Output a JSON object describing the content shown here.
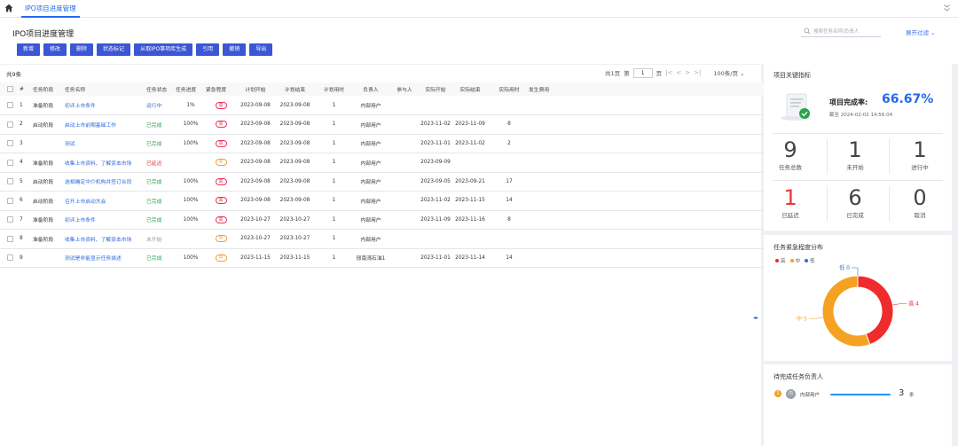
{
  "topbar": {
    "tab": "IPO项目进度管理"
  },
  "header": {
    "title": "IPO项目进度管理",
    "buttons": [
      "新增",
      "修改",
      "删除",
      "状态标记",
      "从取IPO事项库生成",
      "引用",
      "撤销",
      "导出"
    ],
    "search_placeholder": "搜索任务名称/负责人",
    "expand_label": "展开过滤"
  },
  "table": {
    "count_label": "共9条",
    "pager": {
      "total_pages": "共1页",
      "page_label": "第",
      "current_page": "1",
      "page_suffix": "页",
      "page_size": "100条/页"
    },
    "columns": [
      "#",
      "任务阶段",
      "任务名称",
      "任务状态",
      "任务进度",
      "紧急程度",
      "计划开始",
      "计划结束",
      "计划用时",
      "负责人",
      "参与人",
      "实际开始",
      "实际结束",
      "实际用时",
      "发生费用"
    ],
    "rows": [
      {
        "no": "1",
        "stage": "准备阶段",
        "name": "初评上市条件",
        "status": "运行中",
        "status_type": "run",
        "progress": "1%",
        "priority": "高",
        "priority_type": "h",
        "plan_start": "2023-09-08",
        "plan_end": "2023-09-08",
        "plan_days": "1",
        "owner": "内部用户",
        "participants": "",
        "act_start": "",
        "act_end": "",
        "act_days": "",
        "cost": ""
      },
      {
        "no": "2",
        "stage": "启动阶段",
        "name": "启动上市前期基础工作",
        "status": "已完成",
        "status_type": "done",
        "progress": "100%",
        "priority": "高",
        "priority_type": "h",
        "plan_start": "2023-09-08",
        "plan_end": "2023-09-08",
        "plan_days": "1",
        "owner": "内部用户",
        "participants": "",
        "act_start": "2023-11-02",
        "act_end": "2023-11-09",
        "act_days": "8",
        "cost": ""
      },
      {
        "no": "3",
        "stage": "",
        "name": "测试",
        "status": "已完成",
        "status_type": "done",
        "progress": "100%",
        "priority": "高",
        "priority_type": "h",
        "plan_start": "2023-09-08",
        "plan_end": "2023-09-08",
        "plan_days": "1",
        "owner": "内部用户",
        "participants": "",
        "act_start": "2023-11-01",
        "act_end": "2023-11-02",
        "act_days": "2",
        "cost": ""
      },
      {
        "no": "4",
        "stage": "准备阶段",
        "name": "收集上市资料、了解资本市场",
        "status": "已延迟",
        "status_type": "late",
        "progress": "",
        "priority": "中",
        "priority_type": "m",
        "plan_start": "2023-09-08",
        "plan_end": "2023-09-08",
        "plan_days": "1",
        "owner": "内部用户",
        "participants": "",
        "act_start": "2023-09-09",
        "act_end": "",
        "act_days": "",
        "cost": ""
      },
      {
        "no": "5",
        "stage": "启动阶段",
        "name": "选相确定中介机构并签订合同",
        "status": "已完成",
        "status_type": "done",
        "progress": "100%",
        "priority": "高",
        "priority_type": "h",
        "plan_start": "2023-09-08",
        "plan_end": "2023-09-08",
        "plan_days": "1",
        "owner": "内部用户",
        "participants": "",
        "act_start": "2023-09-05",
        "act_end": "2023-09-21",
        "act_days": "17",
        "cost": ""
      },
      {
        "no": "6",
        "stage": "启动阶段",
        "name": "召开上市启动大会",
        "status": "已完成",
        "status_type": "done",
        "progress": "100%",
        "priority": "高",
        "priority_type": "h",
        "plan_start": "2023-09-08",
        "plan_end": "2023-09-08",
        "plan_days": "1",
        "owner": "内部用户",
        "participants": "",
        "act_start": "2023-11-02",
        "act_end": "2023-11-15",
        "act_days": "14",
        "cost": ""
      },
      {
        "no": "7",
        "stage": "准备阶段",
        "name": "初评上市条件",
        "status": "已完成",
        "status_type": "done",
        "progress": "100%",
        "priority": "高",
        "priority_type": "h",
        "plan_start": "2023-10-27",
        "plan_end": "2023-10-27",
        "plan_days": "1",
        "owner": "内部用户",
        "participants": "",
        "act_start": "2023-11-09",
        "act_end": "2023-11-16",
        "act_days": "8",
        "cost": ""
      },
      {
        "no": "8",
        "stage": "准备阶段",
        "name": "收集上市资料、了解资本市场",
        "status": "未开始",
        "status_type": "todo",
        "progress": "",
        "priority": "中",
        "priority_type": "m",
        "plan_start": "2023-10-27",
        "plan_end": "2023-10-27",
        "plan_days": "1",
        "owner": "内部用户",
        "participants": "",
        "act_start": "",
        "act_end": "",
        "act_days": "",
        "cost": ""
      },
      {
        "no": "9",
        "stage": "",
        "name": "测试是非能显示任务描述",
        "status": "已完成",
        "status_type": "done",
        "progress": "100%",
        "priority": "中",
        "priority_type": "m",
        "plan_start": "2023-11-15",
        "plan_end": "2023-11-15",
        "plan_days": "1",
        "owner": "邢南湾石油1",
        "participants": "",
        "act_start": "2023-11-01",
        "act_end": "2023-11-14",
        "act_days": "14",
        "cost": ""
      }
    ]
  },
  "kpi": {
    "title": "项目关键指标",
    "rate_label": "项目完成率:",
    "rate_value": "66.67%",
    "timestamp": "截至 2024-02-02 14:56:04",
    "stats": [
      {
        "num": "9",
        "label": "任务总数",
        "color": "#444444"
      },
      {
        "num": "1",
        "label": "未开始",
        "color": "#444444"
      },
      {
        "num": "1",
        "label": "进行中",
        "color": "#444444"
      },
      {
        "num": "1",
        "label": "已延迟",
        "color": "#e53935"
      },
      {
        "num": "6",
        "label": "已完成",
        "color": "#444444"
      },
      {
        "num": "0",
        "label": "取消",
        "color": "#444444"
      }
    ]
  },
  "priority_chart": {
    "title": "任务紧急程度分布",
    "legend": [
      {
        "name": "高",
        "color": "#ef2b2b"
      },
      {
        "name": "中",
        "color": "#f5a122"
      },
      {
        "name": "低",
        "color": "#2f6fe0"
      }
    ],
    "chart_data": {
      "type": "pie",
      "categories": [
        "高",
        "中",
        "低"
      ],
      "values": [
        4,
        5,
        0
      ],
      "labels": [
        "高 4",
        "中 5",
        "低 0"
      ]
    }
  },
  "owners": {
    "title": "待完成任务负责人",
    "items": [
      {
        "rank": "1",
        "avatar": "内",
        "name": "内部用户",
        "count": "3",
        "unit": "条",
        "fraction": 1.0
      }
    ]
  }
}
